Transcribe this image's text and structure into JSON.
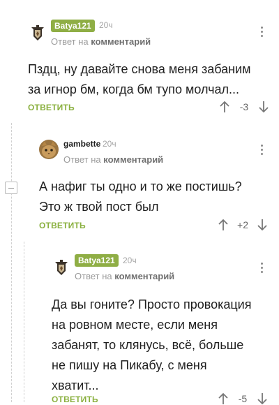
{
  "comments": [
    {
      "user": "Batya121",
      "time": "20ч",
      "reply_prefix": "Ответ на",
      "reply_target": "комментарий",
      "lines": [
        "Пздц, ну давайте снова меня забаним",
        "за игнор бм, когда бм тупо молчал..."
      ],
      "reply_label": "ОТВЕТИТЬ",
      "score": "-3"
    },
    {
      "user": "gambette",
      "time": "20ч",
      "reply_prefix": "Ответ на",
      "reply_target": "комментарий",
      "lines": [
        "А нафиг ты одно и то же постишь?",
        "Это ж твой пост был"
      ],
      "reply_label": "ОТВЕТИТЬ",
      "score": "+2"
    },
    {
      "user": "Batya121",
      "time": "20ч",
      "reply_prefix": "Ответ на",
      "reply_target": "комментарий",
      "lines": [
        "Да вы гоните? Просто провокация",
        "на ровном месте, если меня",
        "забанят, то клянусь, всё, больше",
        "не пишу на Пикабу, с меня",
        "хватит..."
      ],
      "reply_label": "ОТВЕТИТЬ",
      "score": "-5"
    }
  ],
  "colors": {
    "accent": "#8ab03f",
    "badge": "#8fae45",
    "muted": "#a5a5a5"
  },
  "icons": [
    "upvote-arrow-icon",
    "downvote-arrow-icon",
    "more-dots-icon",
    "collapse-minus-icon"
  ]
}
